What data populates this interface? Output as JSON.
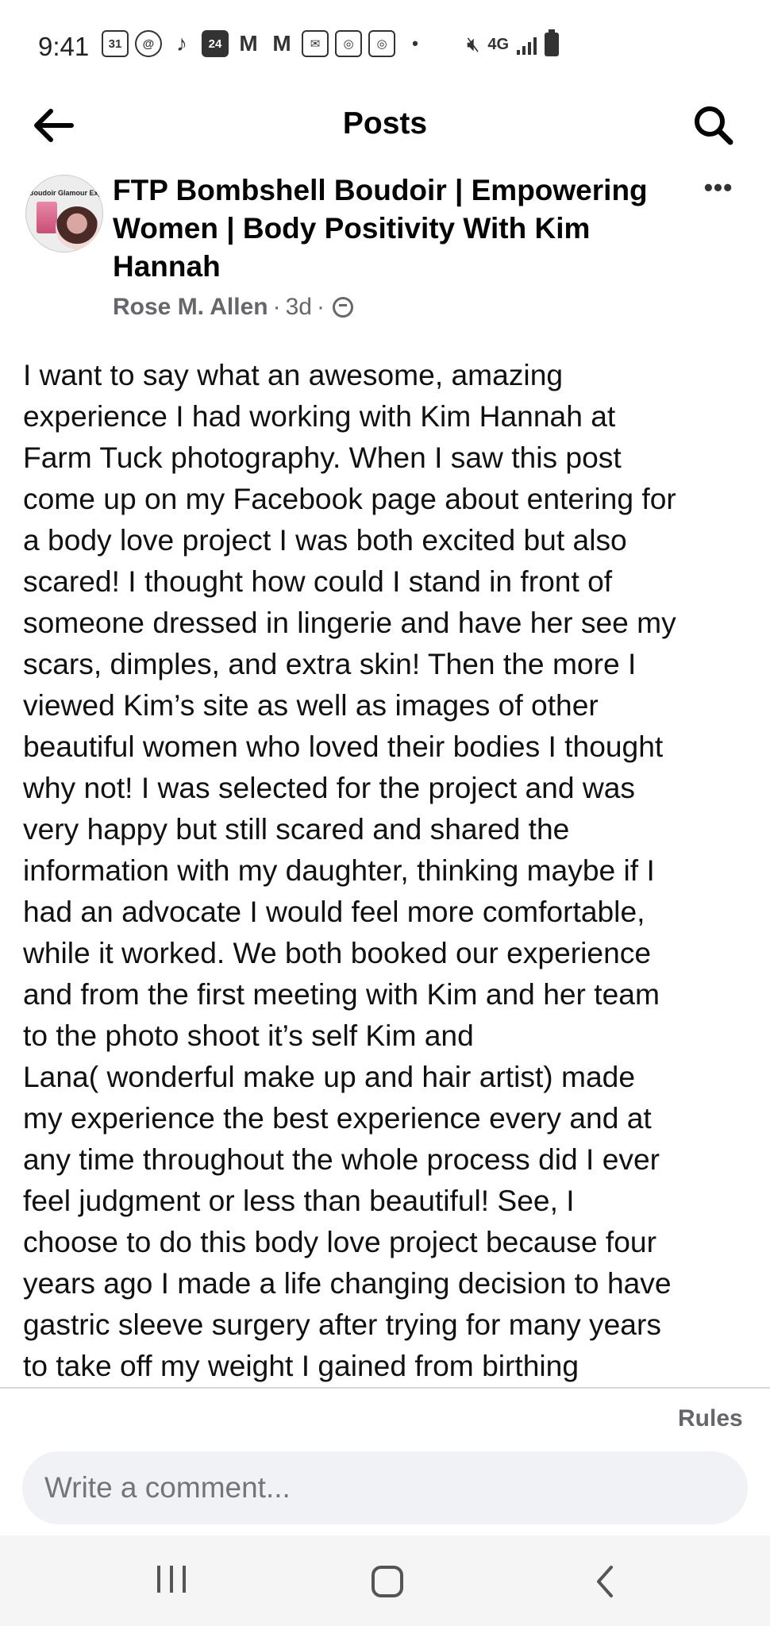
{
  "status_bar": {
    "time": "9:41",
    "calendar_day": "31",
    "badge_number": "24",
    "network": "4G",
    "icons": [
      "calendar-icon",
      "threads-icon",
      "tiktok-icon",
      "calendar-badge-icon",
      "gmail-icon",
      "gmail-icon",
      "mail-icon",
      "instagram-icon",
      "instagram-icon",
      "dot",
      "mute-icon",
      "signal-icon",
      "battery-icon"
    ]
  },
  "header": {
    "title": "Posts",
    "back_icon": "back-arrow-icon",
    "search_icon": "search-icon"
  },
  "post": {
    "page_name": "FTP Bombshell Boudoir | Empowering Women | Body Positivity With Kim Hannah",
    "avatar_text": "Boudoir Glamour Expert",
    "author": "Rose M. Allen",
    "time_ago": "3d",
    "separator": "·",
    "audience_icon": "group-icon",
    "more_icon": "more-options-icon",
    "body_lines": [
      "I want to say what an awesome, amazing",
      "experience I had working with Kim Hannah at",
      "Farm Tuck photography.  When I saw this post",
      "come up on my Facebook page about entering for",
      "a body love project I was both excited but also",
      "scared! I thought how could I stand in front of",
      "someone dressed in lingerie and have her see my",
      "scars, dimples, and extra skin! Then the more I",
      "viewed Kim’s site as well as images of other",
      "beautiful women who loved their bodies I thought",
      "why not! I was selected for the project and was",
      "very happy but still scared and shared the",
      "information with my daughter, thinking maybe if I",
      "had an advocate I would feel more comfortable,",
      "while it worked.  We both booked our experience",
      "and from the first meeting with Kim and her team",
      "to the photo shoot it’s self Kim and",
      "Lana( wonderful make up and hair artist) made",
      "my experience the best experience every and at",
      "any time throughout the whole process did I ever",
      "feel judgment or less than beautiful!  See, I",
      "choose to do this body love project because four",
      "years ago I made a life changing decision to have",
      "gastric sleeve surgery after trying for many years",
      "to take off my weight I gained from birthing"
    ]
  },
  "footer": {
    "rules": "Rules",
    "comment_placeholder": "Write a comment..."
  },
  "nav": {
    "recents_icon": "recents-icon",
    "home_icon": "home-icon",
    "back_icon": "nav-back-icon"
  },
  "colors": {
    "text": "#050505",
    "secondary": "#65676b",
    "comment_bg": "#f0f2f5",
    "nav_bg": "#f5f5f5"
  }
}
